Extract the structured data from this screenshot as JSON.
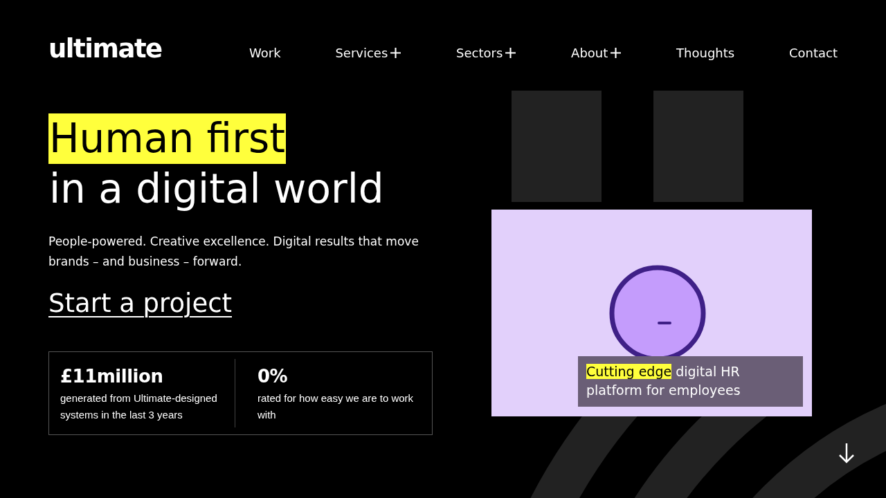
{
  "header": {
    "logo": "ultimate",
    "nav": [
      {
        "label": "Work",
        "has_submenu": false
      },
      {
        "label": "Services",
        "has_submenu": true
      },
      {
        "label": "Sectors",
        "has_submenu": true
      },
      {
        "label": "About",
        "has_submenu": true
      },
      {
        "label": "Thoughts",
        "has_submenu": false
      },
      {
        "label": "Contact",
        "has_submenu": false
      }
    ]
  },
  "hero": {
    "headline": [
      {
        "text": "Human first",
        "highlighted": true
      },
      {
        "text": "in a digital world",
        "highlighted": false
      }
    ],
    "intro": "People-powered. Creative excellence. Digital results that move brands – and business – forward.",
    "cta": "Start a project",
    "stats": [
      {
        "value": "£11million",
        "description": "generated from Ultimate-designed systems in the last 3 years"
      },
      {
        "value": "0%",
        "description": "rated for how easy we are to work with"
      }
    ]
  },
  "showcase": {
    "caption": [
      {
        "text": "Cutting edge",
        "highlighted": true
      },
      {
        "text": " digital HR platform for employees",
        "highlighted": false
      }
    ]
  }
}
